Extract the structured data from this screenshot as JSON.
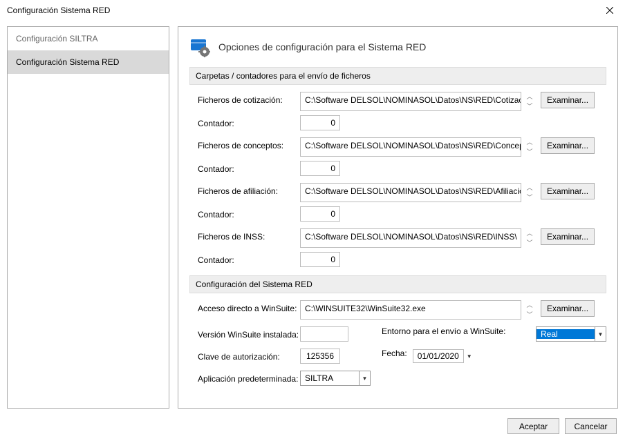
{
  "window_title": "Configuración Sistema RED",
  "sidebar": {
    "items": [
      {
        "label": "Configuración SILTRA"
      },
      {
        "label": "Configuración Sistema RED"
      }
    ]
  },
  "header": {
    "title": "Opciones de configuración para el Sistema RED"
  },
  "sections": {
    "folders_title": "Carpetas / contadores para el envío de ficheros",
    "config_title": "Configuración del Sistema RED"
  },
  "labels": {
    "cotizacion": "Ficheros de cotización:",
    "conceptos": "Ficheros de conceptos:",
    "afiliacion": "Ficheros de afiliación:",
    "inss": "Ficheros de INSS:",
    "contador": "Contador:",
    "winsuite": "Acceso directo a WinSuite:",
    "version": "Versión WinSuite instalada:",
    "envio": "Entorno para el envío a WinSuite:",
    "clave": "Clave de autorización:",
    "fecha": "Fecha:",
    "app": "Aplicación predeterminada:",
    "browse": "Examinar...",
    "accept": "Aceptar",
    "cancel": "Cancelar"
  },
  "values": {
    "cotizacion_path": "C:\\Software DELSOL\\NOMINASOL\\Datos\\NS\\RED\\Cotizacion\\",
    "conceptos_path": "C:\\Software DELSOL\\NOMINASOL\\Datos\\NS\\RED\\Conceptos\\",
    "afiliacion_path": "C:\\Software DELSOL\\NOMINASOL\\Datos\\NS\\RED\\Afiliacion\\",
    "inss_path": "C:\\Software DELSOL\\NOMINASOL\\Datos\\NS\\RED\\INSS\\",
    "winsuite_path": "C:\\WINSUITE32\\WinSuite32.exe",
    "counter_cot": "0",
    "counter_con": "0",
    "counter_afi": "0",
    "counter_inss": "0",
    "version": "",
    "envio": "Real",
    "clave": "125356",
    "fecha": "01/01/2020",
    "app": "SILTRA"
  }
}
